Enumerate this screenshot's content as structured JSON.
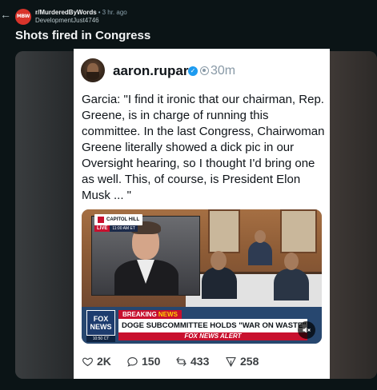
{
  "header": {
    "back_glyph": "←",
    "subreddit_avatar_text": "MBW",
    "subreddit": "r/MurderedByWords",
    "separator": "•",
    "posted_ago": "3 hr. ago",
    "author": "DevelopmentJust4746"
  },
  "post": {
    "title": "Shots fired in Congress"
  },
  "tweet": {
    "handle": "aaron.rupar",
    "posted_ago": "30m",
    "verified_glyph": "✓",
    "text": "Garcia: \"I find it ironic that our chairman, Rep. Greene, is in charge of running this committee. In the last Congress, Chairwoman Greene literally showed a dick pic in our Oversight hearing, so I thought I'd bring one as well. This, of course, is President Elon Musk ... \"",
    "video": {
      "channel_badge": "CAPITOL HILL",
      "live_label": "LIVE",
      "live_time": "11:00 AM ET",
      "breaking_prefix": "BREAKING",
      "breaking_suffix": "NEWS",
      "headline": "DOGE SUBCOMMITTEE HOLDS \"WAR ON WASTE\" HEARING",
      "alert": "FOX NEWS ALERT",
      "network_logo_line1": "FOX",
      "network_logo_line2": "NEWS",
      "network_time": "10:50 CT"
    },
    "stats": {
      "likes": "2K",
      "replies": "150",
      "reposts": "433",
      "shares": "258"
    }
  },
  "colors": {
    "page_background": "#0b1416",
    "subreddit_avatar": "#d9342b",
    "verified_badge": "#1d9bf0",
    "fox_red": "#c8102e",
    "fox_blue": "#27476f"
  },
  "icons": [
    "back-arrow-icon",
    "verified-badge-icon",
    "circle-icon",
    "mute-icon",
    "heart-icon",
    "reply-icon",
    "repost-icon",
    "share-icon"
  ]
}
